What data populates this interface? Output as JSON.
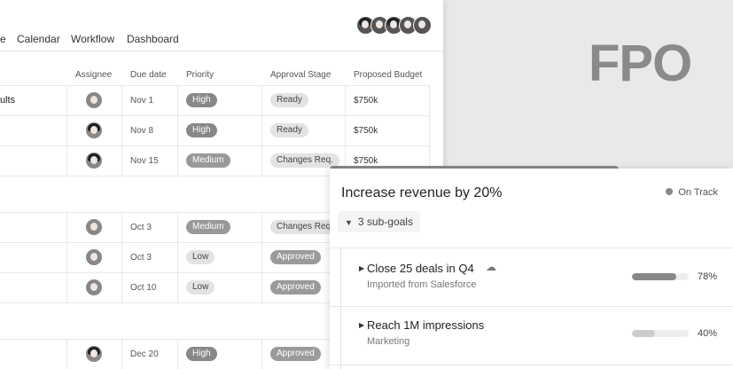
{
  "tabs": [
    {
      "label": "e"
    },
    {
      "label": "Calendar"
    },
    {
      "label": "Workflow"
    },
    {
      "label": "Dashboard"
    }
  ],
  "fpo_label": "FPO",
  "table": {
    "columns": [
      "Assignee",
      "Due date",
      "Priority",
      "Approval Stage",
      "Proposed Budget"
    ],
    "rows": [
      {
        "name": "ults",
        "due": "Nov 1",
        "priority": "High",
        "stage": "Ready",
        "budget": "$750k"
      },
      {
        "name": "",
        "due": "Nov 8",
        "priority": "High",
        "stage": "Ready",
        "budget": "$750k"
      },
      {
        "name": "",
        "due": "Nov 15",
        "priority": "Medium",
        "stage": "Changes Req.",
        "budget": "$750k"
      },
      {
        "name": "",
        "due": "Oct 3",
        "priority": "Medium",
        "stage": "Changes Req",
        "budget": ""
      },
      {
        "name": "",
        "due": "Oct 3",
        "priority": "Low",
        "stage": "Approved",
        "budget": ""
      },
      {
        "name": "",
        "due": "Oct 10",
        "priority": "Low",
        "stage": "Approved",
        "budget": ""
      },
      {
        "name": "",
        "due": "Dec 20",
        "priority": "High",
        "stage": "Approved",
        "budget": ""
      }
    ]
  },
  "goal": {
    "title": "Increase revenue by 20%",
    "status": "On Track",
    "subgoals_label": "3 sub-goals",
    "subgoals": [
      {
        "name": "Close 25 deals in Q4",
        "source": "Imported from Salesforce",
        "progress": 78,
        "progress_label": "78%"
      },
      {
        "name": "Reach 1M impressions",
        "source": "Marketing",
        "progress": 40,
        "progress_label": "40%"
      }
    ]
  },
  "colors": {
    "accent_gray": "#888888"
  }
}
